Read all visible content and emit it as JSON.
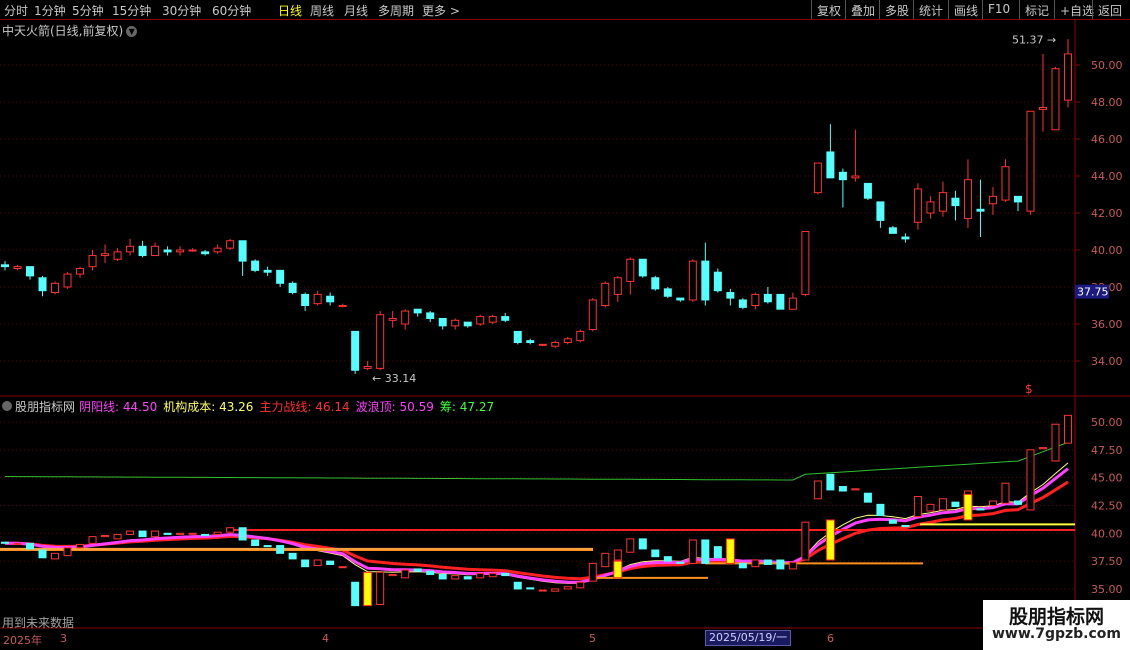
{
  "toolbar": {
    "left": [
      {
        "label": "分时"
      },
      {
        "label": "1分钟"
      },
      {
        "label": "5分钟"
      },
      {
        "label": "15分钟"
      },
      {
        "label": "30分钟"
      },
      {
        "label": "60分钟"
      },
      {
        "label": "日线",
        "active": true
      },
      {
        "label": "周线"
      },
      {
        "label": "月线"
      },
      {
        "label": "多周期"
      },
      {
        "label": "更多 >"
      }
    ],
    "right": [
      {
        "label": "复权"
      },
      {
        "label": "叠加"
      },
      {
        "label": "多股"
      },
      {
        "label": "统计"
      },
      {
        "label": "画线"
      },
      {
        "label": "F10"
      },
      {
        "label": "标记"
      },
      {
        "label": "+自选"
      },
      {
        "label": "返回"
      }
    ]
  },
  "main_title": "中天火箭(日线,前复权)",
  "price_axis": {
    "ticks": [
      "50.00",
      "48.00",
      "46.00",
      "44.00",
      "42.00",
      "40.00",
      "38.00",
      "36.00",
      "34.00"
    ],
    "current": "37.75"
  },
  "annotations": {
    "high": "51.37",
    "low": "33.14"
  },
  "indicator": {
    "name": "股朋指标网",
    "items": [
      {
        "label": "阴阳线: 44.50",
        "color": "#ff40ff"
      },
      {
        "label": "机构成本: 43.26",
        "color": "#ffff60"
      },
      {
        "label": "主力战线: 46.14",
        "color": "#ff3030"
      },
      {
        "label": "波浪顶: 50.59",
        "color": "#ff40ff"
      },
      {
        "label": "筹: 47.27",
        "color": "#40ff40"
      }
    ],
    "axis": [
      "50.00",
      "47.50",
      "45.00",
      "42.50",
      "40.00",
      "37.50",
      "35.00"
    ]
  },
  "note": "用到未来数据",
  "watermark": {
    "title": "股朋指标网",
    "url": "www.7gpzb.com"
  },
  "dates": {
    "year": "2025年",
    "m3": "3",
    "m4": "4",
    "m5": "5",
    "m6": "6",
    "cursor": "2025/05/19/一"
  },
  "colors": {
    "up": "#ff3232",
    "down": "#54ffff",
    "bg": "#000000",
    "grid": "#8b0000"
  },
  "chart_data": {
    "type": "candlestick",
    "ohlc": [
      [
        39.2,
        39.4,
        38.9,
        39.1
      ],
      [
        39.0,
        39.2,
        38.9,
        39.1
      ],
      [
        39.1,
        39.1,
        38.4,
        38.6
      ],
      [
        38.5,
        38.6,
        37.5,
        37.8
      ],
      [
        37.7,
        38.3,
        37.6,
        38.2
      ],
      [
        38.0,
        38.8,
        37.9,
        38.7
      ],
      [
        38.7,
        39.1,
        38.5,
        39.0
      ],
      [
        39.1,
        40.0,
        38.9,
        39.7
      ],
      [
        39.7,
        40.3,
        39.3,
        39.8
      ],
      [
        39.5,
        40.1,
        39.4,
        39.9
      ],
      [
        39.9,
        40.6,
        39.7,
        40.2
      ],
      [
        40.2,
        40.5,
        39.6,
        39.7
      ],
      [
        39.7,
        40.4,
        39.7,
        40.2
      ],
      [
        40.0,
        40.2,
        39.7,
        39.9
      ],
      [
        39.9,
        40.2,
        39.7,
        40.0
      ],
      [
        40.0,
        40.1,
        39.9,
        40.0
      ],
      [
        39.9,
        40.0,
        39.7,
        39.8
      ],
      [
        39.9,
        40.3,
        39.8,
        40.1
      ],
      [
        40.1,
        40.6,
        40.0,
        40.5
      ],
      [
        40.5,
        40.5,
        38.6,
        39.4
      ],
      [
        39.4,
        39.5,
        38.8,
        38.9
      ],
      [
        38.9,
        39.1,
        38.6,
        38.8
      ],
      [
        38.9,
        38.9,
        38.0,
        38.2
      ],
      [
        38.2,
        38.3,
        37.6,
        37.7
      ],
      [
        37.6,
        37.7,
        36.7,
        37.0
      ],
      [
        37.1,
        37.8,
        37.0,
        37.6
      ],
      [
        37.5,
        37.7,
        37.0,
        37.2
      ],
      [
        37.0,
        37.1,
        36.9,
        37.0
      ],
      [
        35.6,
        35.6,
        33.3,
        33.5
      ],
      [
        33.6,
        34.0,
        33.5,
        33.7
      ],
      [
        33.6,
        36.7,
        33.5,
        36.5
      ],
      [
        36.2,
        36.7,
        35.8,
        36.3
      ],
      [
        36.0,
        36.8,
        35.7,
        36.7
      ],
      [
        36.8,
        36.8,
        36.4,
        36.6
      ],
      [
        36.6,
        36.7,
        36.1,
        36.3
      ],
      [
        36.3,
        36.3,
        35.7,
        35.9
      ],
      [
        35.9,
        36.3,
        35.7,
        36.2
      ],
      [
        36.1,
        36.1,
        35.8,
        35.9
      ],
      [
        36.0,
        36.5,
        35.9,
        36.4
      ],
      [
        36.1,
        36.5,
        36.0,
        36.4
      ],
      [
        36.4,
        36.6,
        36.1,
        36.2
      ],
      [
        35.6,
        35.6,
        34.9,
        35.0
      ],
      [
        35.1,
        35.2,
        34.9,
        35.0
      ],
      [
        34.9,
        34.9,
        34.8,
        34.9
      ],
      [
        34.8,
        35.1,
        34.7,
        35.0
      ],
      [
        35.0,
        35.3,
        34.9,
        35.2
      ],
      [
        35.1,
        35.7,
        35.0,
        35.6
      ],
      [
        35.7,
        37.4,
        35.6,
        37.3
      ],
      [
        37.0,
        38.3,
        36.9,
        38.2
      ],
      [
        37.6,
        38.6,
        37.2,
        38.5
      ],
      [
        38.3,
        39.6,
        37.6,
        39.5
      ],
      [
        39.5,
        39.5,
        38.5,
        38.6
      ],
      [
        38.5,
        38.6,
        37.8,
        37.9
      ],
      [
        37.9,
        38.0,
        37.4,
        37.5
      ],
      [
        37.4,
        37.4,
        37.2,
        37.3
      ],
      [
        37.3,
        39.5,
        37.2,
        39.4
      ],
      [
        39.4,
        40.4,
        37.0,
        37.3
      ],
      [
        38.8,
        39.0,
        37.7,
        37.8
      ],
      [
        37.7,
        37.9,
        37.0,
        37.4
      ],
      [
        37.3,
        37.4,
        36.8,
        36.9
      ],
      [
        37.0,
        37.7,
        36.8,
        37.6
      ],
      [
        37.6,
        38.0,
        37.1,
        37.2
      ],
      [
        37.6,
        37.6,
        36.8,
        36.8
      ],
      [
        36.8,
        37.7,
        36.8,
        37.4
      ],
      [
        37.6,
        41.0,
        37.5,
        41.0
      ],
      [
        43.1,
        44.7,
        43.0,
        44.7
      ],
      [
        45.3,
        46.8,
        43.9,
        43.9
      ],
      [
        44.2,
        44.4,
        42.3,
        43.8
      ],
      [
        43.9,
        46.5,
        43.7,
        44.0
      ],
      [
        43.6,
        43.6,
        42.7,
        42.8
      ],
      [
        42.6,
        42.6,
        41.2,
        41.6
      ],
      [
        41.2,
        41.3,
        40.9,
        40.9
      ],
      [
        40.7,
        40.9,
        40.4,
        40.6
      ],
      [
        41.5,
        43.6,
        41.1,
        43.3
      ],
      [
        42.0,
        42.9,
        41.7,
        42.6
      ],
      [
        42.1,
        43.7,
        41.8,
        43.1
      ],
      [
        42.8,
        43.2,
        41.6,
        42.4
      ],
      [
        41.7,
        44.9,
        41.2,
        43.8
      ],
      [
        42.2,
        43.8,
        40.7,
        42.1
      ],
      [
        42.5,
        43.4,
        41.9,
        42.9
      ],
      [
        42.7,
        44.9,
        42.6,
        44.5
      ],
      [
        42.9,
        42.9,
        42.1,
        42.6
      ],
      [
        42.1,
        47.5,
        41.9,
        47.5
      ],
      [
        47.6,
        50.6,
        46.4,
        47.7
      ],
      [
        46.5,
        49.9,
        46.5,
        49.8
      ],
      [
        48.1,
        51.4,
        47.7,
        50.6
      ]
    ]
  }
}
